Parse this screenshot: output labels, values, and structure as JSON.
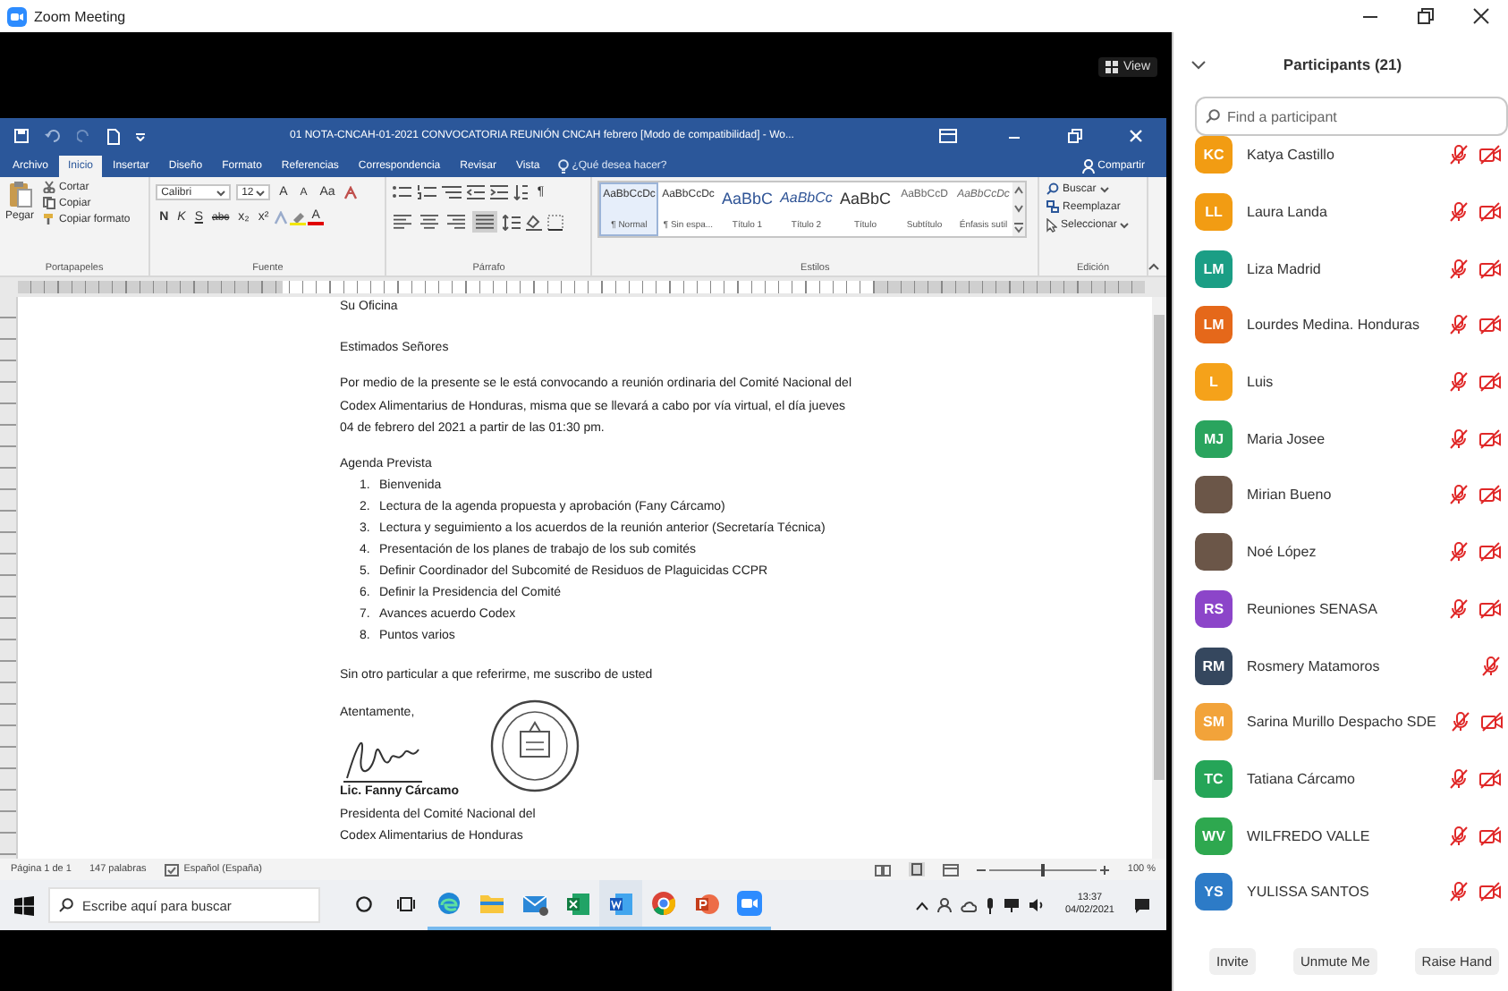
{
  "window": {
    "title": "Zoom Meeting"
  },
  "meeting_toolbar": {
    "view_label": "View"
  },
  "shared_screen": {
    "word": {
      "title": "01 NOTA-CNCAH-01-2021 CONVOCATORIA REUNIÓN CNCAH febrero [Modo de compatibilidad] - Wo...",
      "tabs": [
        {
          "label": "Archivo",
          "selected": false
        },
        {
          "label": "Inicio",
          "selected": true
        },
        {
          "label": "Insertar",
          "selected": false
        },
        {
          "label": "Diseño",
          "selected": false
        },
        {
          "label": "Formato",
          "selected": false
        },
        {
          "label": "Referencias",
          "selected": false
        },
        {
          "label": "Correspondencia",
          "selected": false
        },
        {
          "label": "Revisar",
          "selected": false
        },
        {
          "label": "Vista",
          "selected": false
        }
      ],
      "tell_me": "¿Qué desea hacer?",
      "share": "Compartir",
      "clipboard": {
        "paste": "Pegar",
        "cut": "Cortar",
        "copy": "Copiar",
        "format_painter": "Copiar formato",
        "group": "Portapapeles"
      },
      "font": {
        "name": "Calibri",
        "size": "12",
        "grow": "A",
        "shrink": "A",
        "case": "Aa",
        "bold": "N",
        "italic": "K",
        "underline": "S",
        "strikethrough": "abc",
        "subscript": "x₂",
        "superscript": "x²",
        "text_color_button": "A",
        "group": "Fuente"
      },
      "paragraph": {
        "show_marks": "¶",
        "group": "Párrafo"
      },
      "styles": {
        "items": [
          {
            "preview": "AaBbCcDc",
            "name": "¶ Normal",
            "kind": "normal",
            "selected": true
          },
          {
            "preview": "AaBbCcDc",
            "name": "¶ Sin espa...",
            "kind": "normal",
            "selected": false
          },
          {
            "preview": "AaBbC",
            "name": "Título 1",
            "kind": "heading1",
            "selected": false
          },
          {
            "preview": "AaBbCc",
            "name": "Título 2",
            "kind": "heading2",
            "selected": false
          },
          {
            "preview": "AaBbC",
            "name": "Título",
            "kind": "title",
            "selected": false
          },
          {
            "preview": "AaBbCcD",
            "name": "Subtítulo",
            "kind": "subtitle",
            "selected": false
          },
          {
            "preview": "AaBbCcDc",
            "name": "Énfasis sutil",
            "kind": "emphasis",
            "selected": false
          }
        ],
        "group": "Estilos"
      },
      "editing": {
        "find": "Buscar",
        "replace": "Reemplazar",
        "select": "Seleccionar",
        "group": "Edición"
      },
      "document": {
        "recipient": "Su Oficina",
        "greeting": "Estimados Señores",
        "body": "Por medio de la presente se le está convocando a reunión ordinaria del Comité Nacional del Codex Alimentarius de Honduras, misma que se llevará a cabo por vía virtual, el día jueves 04 de febrero del 2021 a partir de las 01:30 pm.",
        "agenda_title": "Agenda Prevista",
        "agenda": [
          {
            "number": "1.",
            "text": "Bienvenida"
          },
          {
            "number": "2.",
            "text": "Lectura de la agenda propuesta y aprobación (Fany Cárcamo)"
          },
          {
            "number": "3.",
            "text": "Lectura y seguimiento a los acuerdos de la reunión anterior (Secretaría Técnica)"
          },
          {
            "number": "4.",
            "text": "Presentación de los planes de trabajo de los sub comités"
          },
          {
            "number": "5.",
            "text": "Definir Coordinador del Subcomité de Residuos de Plaguicidas CCPR"
          },
          {
            "number": "6.",
            "text": "Definir la Presidencia del Comité"
          },
          {
            "number": "7.",
            "text": "Avances acuerdo Codex"
          },
          {
            "number": "8.",
            "text": "Puntos varios"
          }
        ],
        "closing": "Sin otro particular a que referirme, me suscribo de usted",
        "farewell": "Atentamente,",
        "signer": "Lic. Fanny Cárcamo",
        "signer_title": [
          "Presidenta del Comité Nacional del",
          "Codex Alimentarius de Honduras"
        ]
      },
      "status_bar": {
        "page": "Página 1 de 1",
        "words": "147 palabras",
        "language": "Español (España)",
        "zoom": "100 %",
        "zoom_slider": {
          "level": 0.5
        }
      }
    },
    "taskbar": {
      "search_placeholder": "Escribe aquí para buscar",
      "apps": [
        {
          "kind": "edge",
          "selected": false
        },
        {
          "kind": "explorer",
          "selected": false
        },
        {
          "kind": "mail",
          "selected": false
        },
        {
          "kind": "excel",
          "selected": false
        },
        {
          "kind": "word",
          "selected": true
        },
        {
          "kind": "chrome",
          "selected": false
        },
        {
          "kind": "powerpoint",
          "selected": false
        },
        {
          "kind": "zoom",
          "selected": false
        }
      ],
      "time": "13:37",
      "date": "04/02/2021"
    }
  },
  "participants": {
    "title": "Participants (21)",
    "search_placeholder": "Find a participant",
    "items": [
      {
        "name": "Katya Castillo",
        "avatar": {
          "kind": "initials",
          "initials": "KC",
          "color": "#f29c13"
        },
        "mic_muted": true,
        "video_off": true
      },
      {
        "name": "Laura Landa",
        "avatar": {
          "kind": "initials",
          "initials": "LL",
          "color": "#f29c13"
        },
        "mic_muted": true,
        "video_off": true
      },
      {
        "name": "Liza Madrid",
        "avatar": {
          "kind": "initials",
          "initials": "LM",
          "color": "#1b9e85"
        },
        "mic_muted": true,
        "video_off": true
      },
      {
        "name": "Lourdes Medina. Honduras",
        "avatar": {
          "kind": "initials",
          "initials": "LM",
          "color": "#e5681a"
        },
        "mic_muted": true,
        "video_off": true
      },
      {
        "name": "Luis",
        "avatar": {
          "kind": "initials",
          "initials": "L",
          "color": "#f5a21a"
        },
        "mic_muted": true,
        "video_off": true
      },
      {
        "name": "Maria Josee",
        "avatar": {
          "kind": "initials",
          "initials": "MJ",
          "color": "#2aa45e"
        },
        "mic_muted": true,
        "video_off": true
      },
      {
        "name": "Mirian Bueno",
        "avatar": {
          "kind": "photo"
        },
        "mic_muted": true,
        "video_off": true
      },
      {
        "name": "Noé López",
        "avatar": {
          "kind": "photo"
        },
        "mic_muted": true,
        "video_off": true
      },
      {
        "name": "Reuniones SENASA",
        "avatar": {
          "kind": "initials",
          "initials": "RS",
          "color": "#8c45c9"
        },
        "mic_muted": true,
        "video_off": true
      },
      {
        "name": "Rosmery Matamoros",
        "avatar": {
          "kind": "initials",
          "initials": "RM",
          "color": "#35475e"
        },
        "mic_muted": true,
        "video_off": false
      },
      {
        "name": "Sarina Murillo Despacho SDE",
        "avatar": {
          "kind": "initials",
          "initials": "SM",
          "color": "#f2a33a"
        },
        "mic_muted": true,
        "video_off": true
      },
      {
        "name": "Tatiana Cárcamo",
        "avatar": {
          "kind": "initials",
          "initials": "TC",
          "color": "#25a558"
        },
        "mic_muted": true,
        "video_off": true
      },
      {
        "name": "WILFREDO VALLE",
        "avatar": {
          "kind": "initials",
          "initials": "WV",
          "color": "#2ea84f"
        },
        "mic_muted": true,
        "video_off": true
      },
      {
        "name": "YULISSA SANTOS",
        "avatar": {
          "kind": "initials",
          "initials": "YS",
          "color": "#2d7bc7"
        },
        "mic_muted": true,
        "video_off": true
      }
    ],
    "buttons": [
      "Invite",
      "Unmute Me",
      "Raise Hand"
    ]
  }
}
